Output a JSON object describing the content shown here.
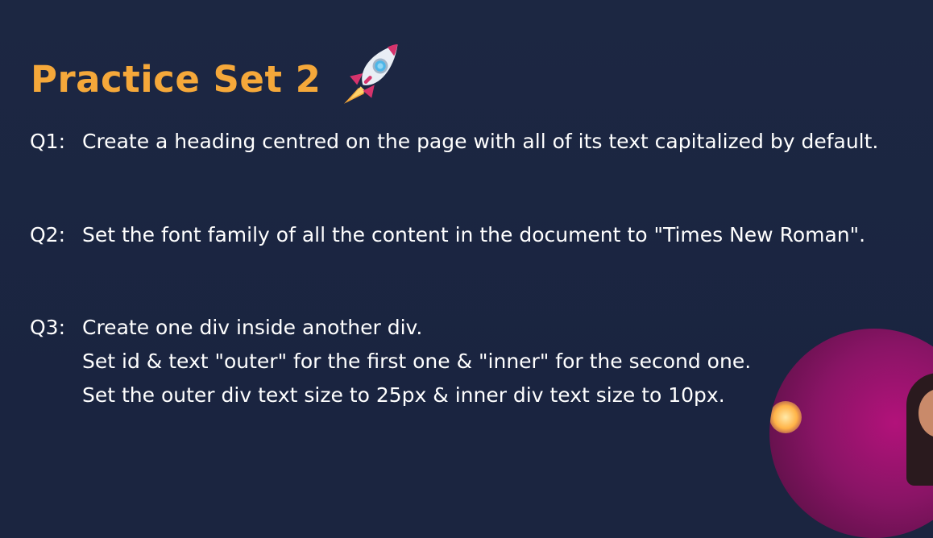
{
  "slide": {
    "title": "Practice Set 2",
    "title_icon": "rocket-icon",
    "colors": {
      "background": "#1b2540",
      "title": "#f5a83a",
      "text": "#ffffff"
    },
    "questions": [
      {
        "label": "Q1:",
        "lines": [
          "Create a heading centred on the page with all of its text capitalized by default."
        ]
      },
      {
        "label": "Q2:",
        "lines": [
          "Set the font family of all the content in the document to \"Times New Roman\"."
        ]
      },
      {
        "label": "Q3:",
        "lines": [
          "Create one div inside another div.",
          "Set id & text \"outer\" for the first one & \"inner\" for the second one.",
          "Set the outer div text size to 25px & inner div text size to 10px."
        ]
      }
    ]
  }
}
